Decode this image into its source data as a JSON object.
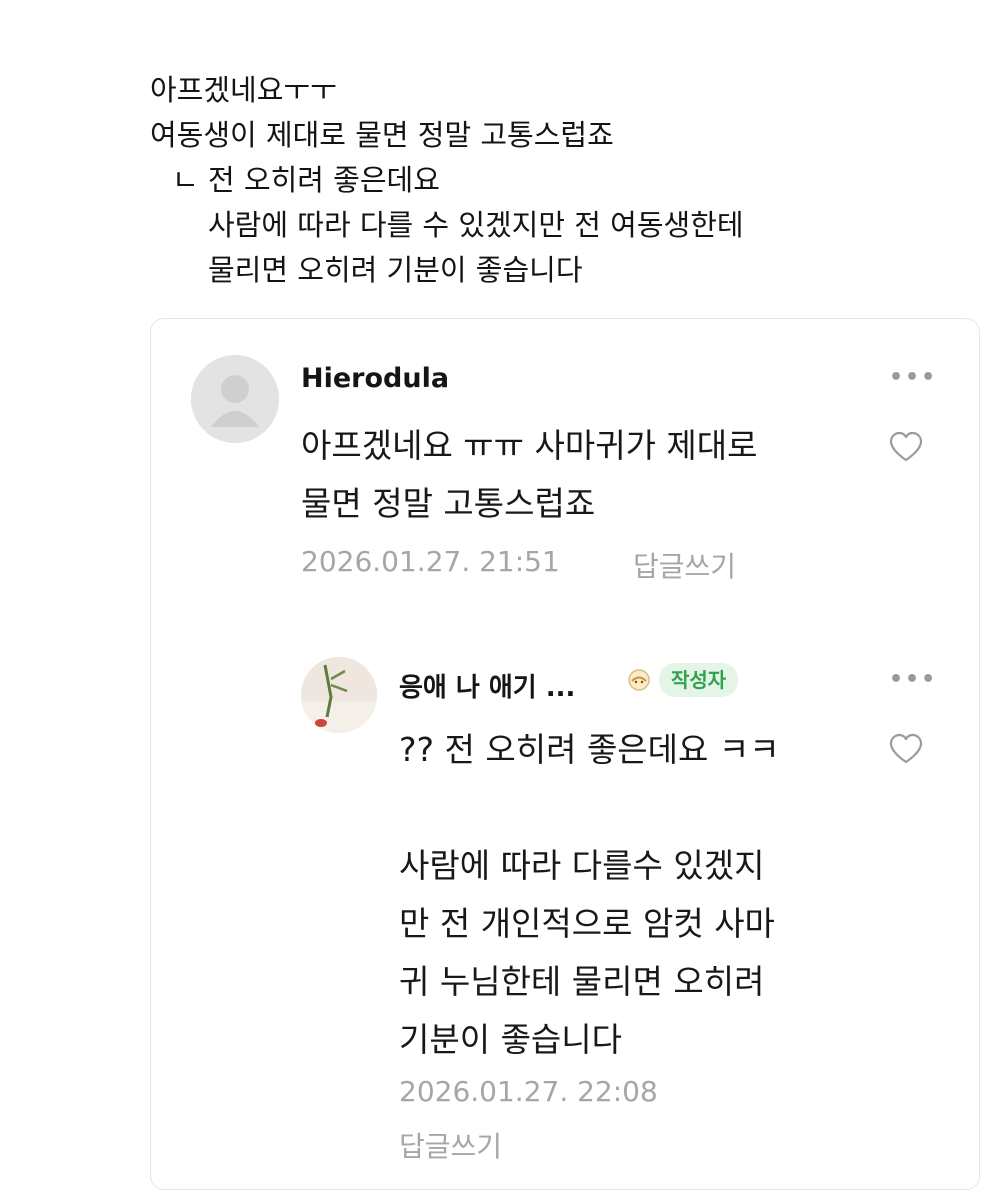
{
  "caption": {
    "line1": "아프겠네요ㅜㅜ",
    "line2": "여동생이 제대로 물면 정말 고통스럽죠",
    "reply_mark": "ㄴ",
    "reply_line1": "전 오히려 좋은데요",
    "reply_line2": "사람에 따라 다를 수 있겠지만 전 여동생한테",
    "reply_line3": "물리면 오히려 기분이 좋습니다"
  },
  "comments": [
    {
      "author": "Hierodula",
      "more_label": "•••",
      "text_lines": [
        "아프겠네요 ㅠㅠ 사마귀가 제대로",
        "물면 정말 고통스럽죠"
      ],
      "date": "2026.01.27. 21:51",
      "reply_label": "답글쓰기",
      "avatar_icon": "default-user-icon",
      "like_icon": "heart-outline-icon"
    },
    {
      "author": "응애 나 애기 ...",
      "badge": "작성자",
      "more_label": "•••",
      "text_lines_a": [
        "?? 전 오히려 좋은데요 ㅋㅋ"
      ],
      "text_lines_b": [
        "사람에 따라 다를수 있겠지",
        "만 전 개인적으로 암컷 사마",
        "귀 누님한테 물리면 오히려",
        "기분이 좋습니다"
      ],
      "date": "2026.01.27. 22:08",
      "reply_label": "답글쓰기",
      "avatar_icon": "mantis-photo-avatar",
      "like_icon": "heart-outline-icon"
    }
  ],
  "colors": {
    "badge_bg": "#e4f4e7",
    "badge_text": "#2fa24d",
    "meta_text": "#a6a6a6",
    "border": "#e6e6e6"
  }
}
